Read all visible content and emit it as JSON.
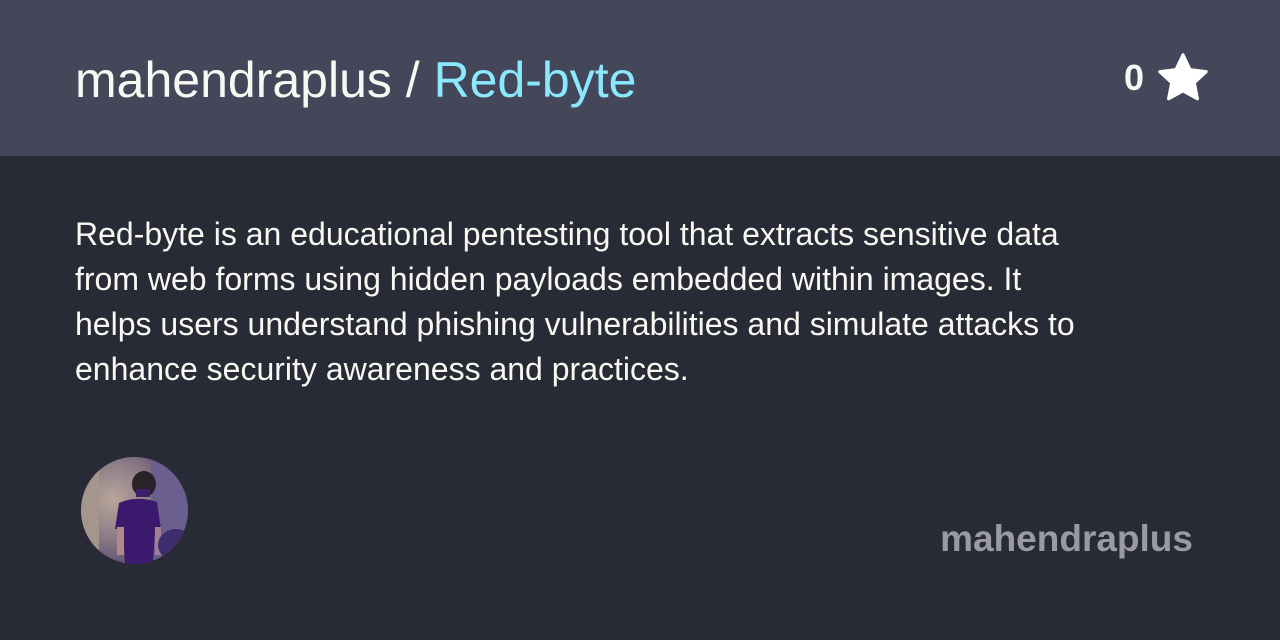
{
  "header": {
    "owner": "mahendraplus",
    "separator": " / ",
    "repo": "Red-byte",
    "star_count": "0",
    "star_icon": "star-icon"
  },
  "description": "Red-byte is an educational pentesting tool that extracts sensitive data from web forms using hidden payloads embedded within images. It helps users understand phishing vulnerabilities and simulate attacks to enhance security awareness and practices.",
  "footer": {
    "author": "mahendraplus"
  },
  "colors": {
    "header_bg": "#44475a",
    "body_bg": "#282a36",
    "repo": "#8be9fd",
    "text": "#f8f8f2",
    "author": "#9a9aa2"
  }
}
